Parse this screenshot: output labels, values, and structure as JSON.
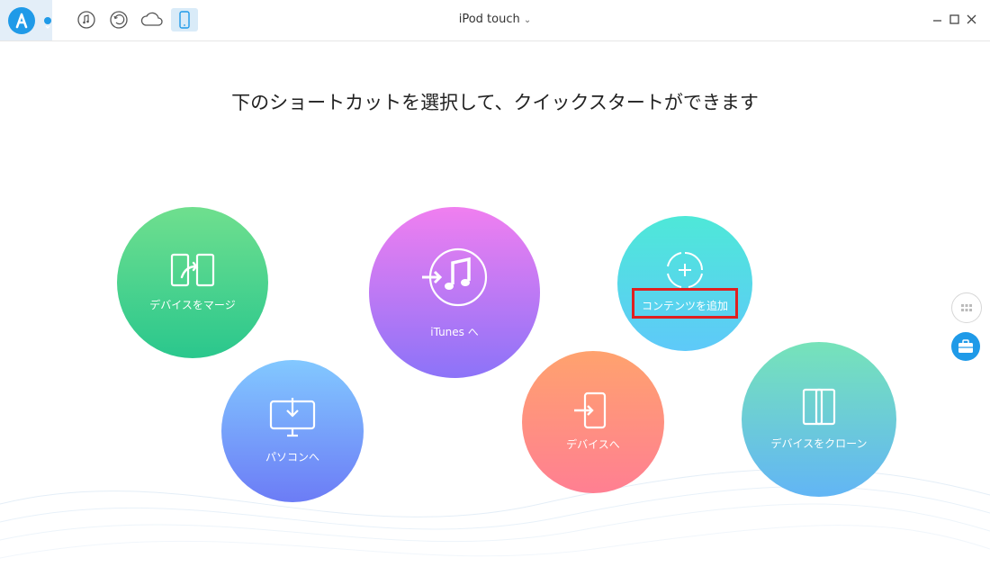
{
  "app": {
    "title": "iPod touch"
  },
  "toolbar": {
    "icons": [
      "music-icon",
      "restore-icon",
      "cloud-icon",
      "phone-icon"
    ]
  },
  "headline": "下のショートカットを選択して、クイックスタートができます",
  "shortcuts": [
    {
      "label": "デバイスをマージ",
      "icon": "merge-devices-icon",
      "color_top": "#6fdf8e",
      "color_bottom": "#2ac78d"
    },
    {
      "label": "パソコンへ",
      "icon": "to-computer-icon",
      "color_top": "#82c8ff",
      "color_bottom": "#6c7cf6"
    },
    {
      "label": "iTunes へ",
      "icon": "to-itunes-icon",
      "color_top": "#f07ff0",
      "color_bottom": "#8c73f8"
    },
    {
      "label": "コンテンツを追加",
      "icon": "add-content-icon",
      "color_top": "#4ee8d8",
      "color_bottom": "#5ec9f9"
    },
    {
      "label": "デバイスへ",
      "icon": "to-device-icon",
      "color_top": "#ffa26e",
      "color_bottom": "#ff7f92"
    },
    {
      "label": "デバイスをクローン",
      "icon": "clone-device-icon",
      "color_top": "#76e3b9",
      "color_bottom": "#62b5f5"
    }
  ],
  "colors": {
    "accent": "#1f9ae8",
    "highlight": "#e02020"
  }
}
